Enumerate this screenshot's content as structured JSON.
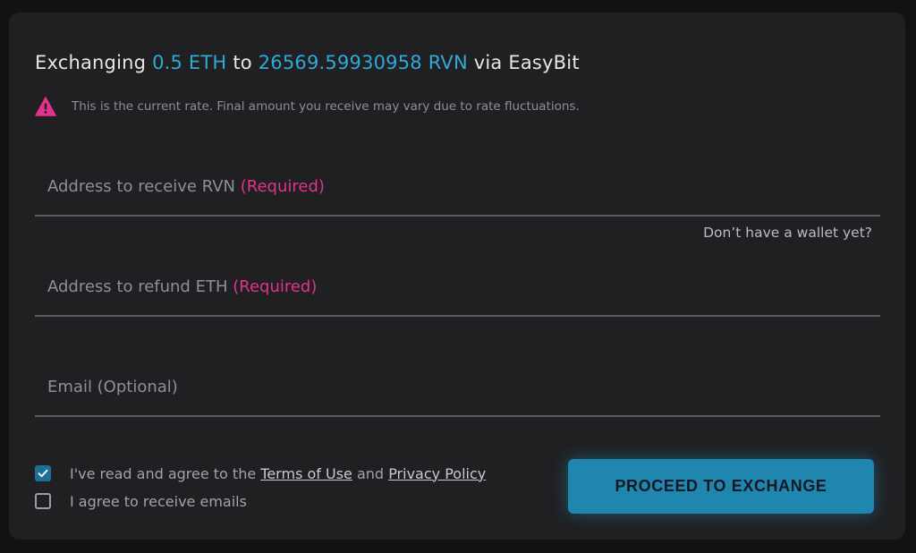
{
  "header": {
    "prefix": "Exchanging",
    "from_amount": "0.5 ETH",
    "connector": "to",
    "to_amount": "26569.59930958 RVN",
    "suffix": "via EasyBit"
  },
  "notice": {
    "icon": "warning-triangle-icon",
    "text": "This is the current rate. Final amount you receive may vary due to rate fluctuations."
  },
  "fields": {
    "receive": {
      "label": "Address to receive RVN",
      "required": "(Required)",
      "value": ""
    },
    "refund": {
      "label": "Address to refund ETH",
      "required": "(Required)",
      "value": ""
    },
    "email": {
      "label": "Email (Optional)",
      "value": ""
    }
  },
  "wallet_link": "Don’t have a wallet yet?",
  "agreements": {
    "terms": {
      "checked": true,
      "text_before": "I've read and agree to the",
      "terms_link": "Terms of Use",
      "and": "and",
      "privacy_link": "Privacy Policy"
    },
    "emails": {
      "checked": false,
      "text": "I agree to receive emails"
    }
  },
  "proceed_button": "PROCEED TO EXCHANGE",
  "colors": {
    "accent": "#2fa9d6",
    "required": "#e0338a",
    "button": "#1f86b0",
    "background": "#202022"
  }
}
